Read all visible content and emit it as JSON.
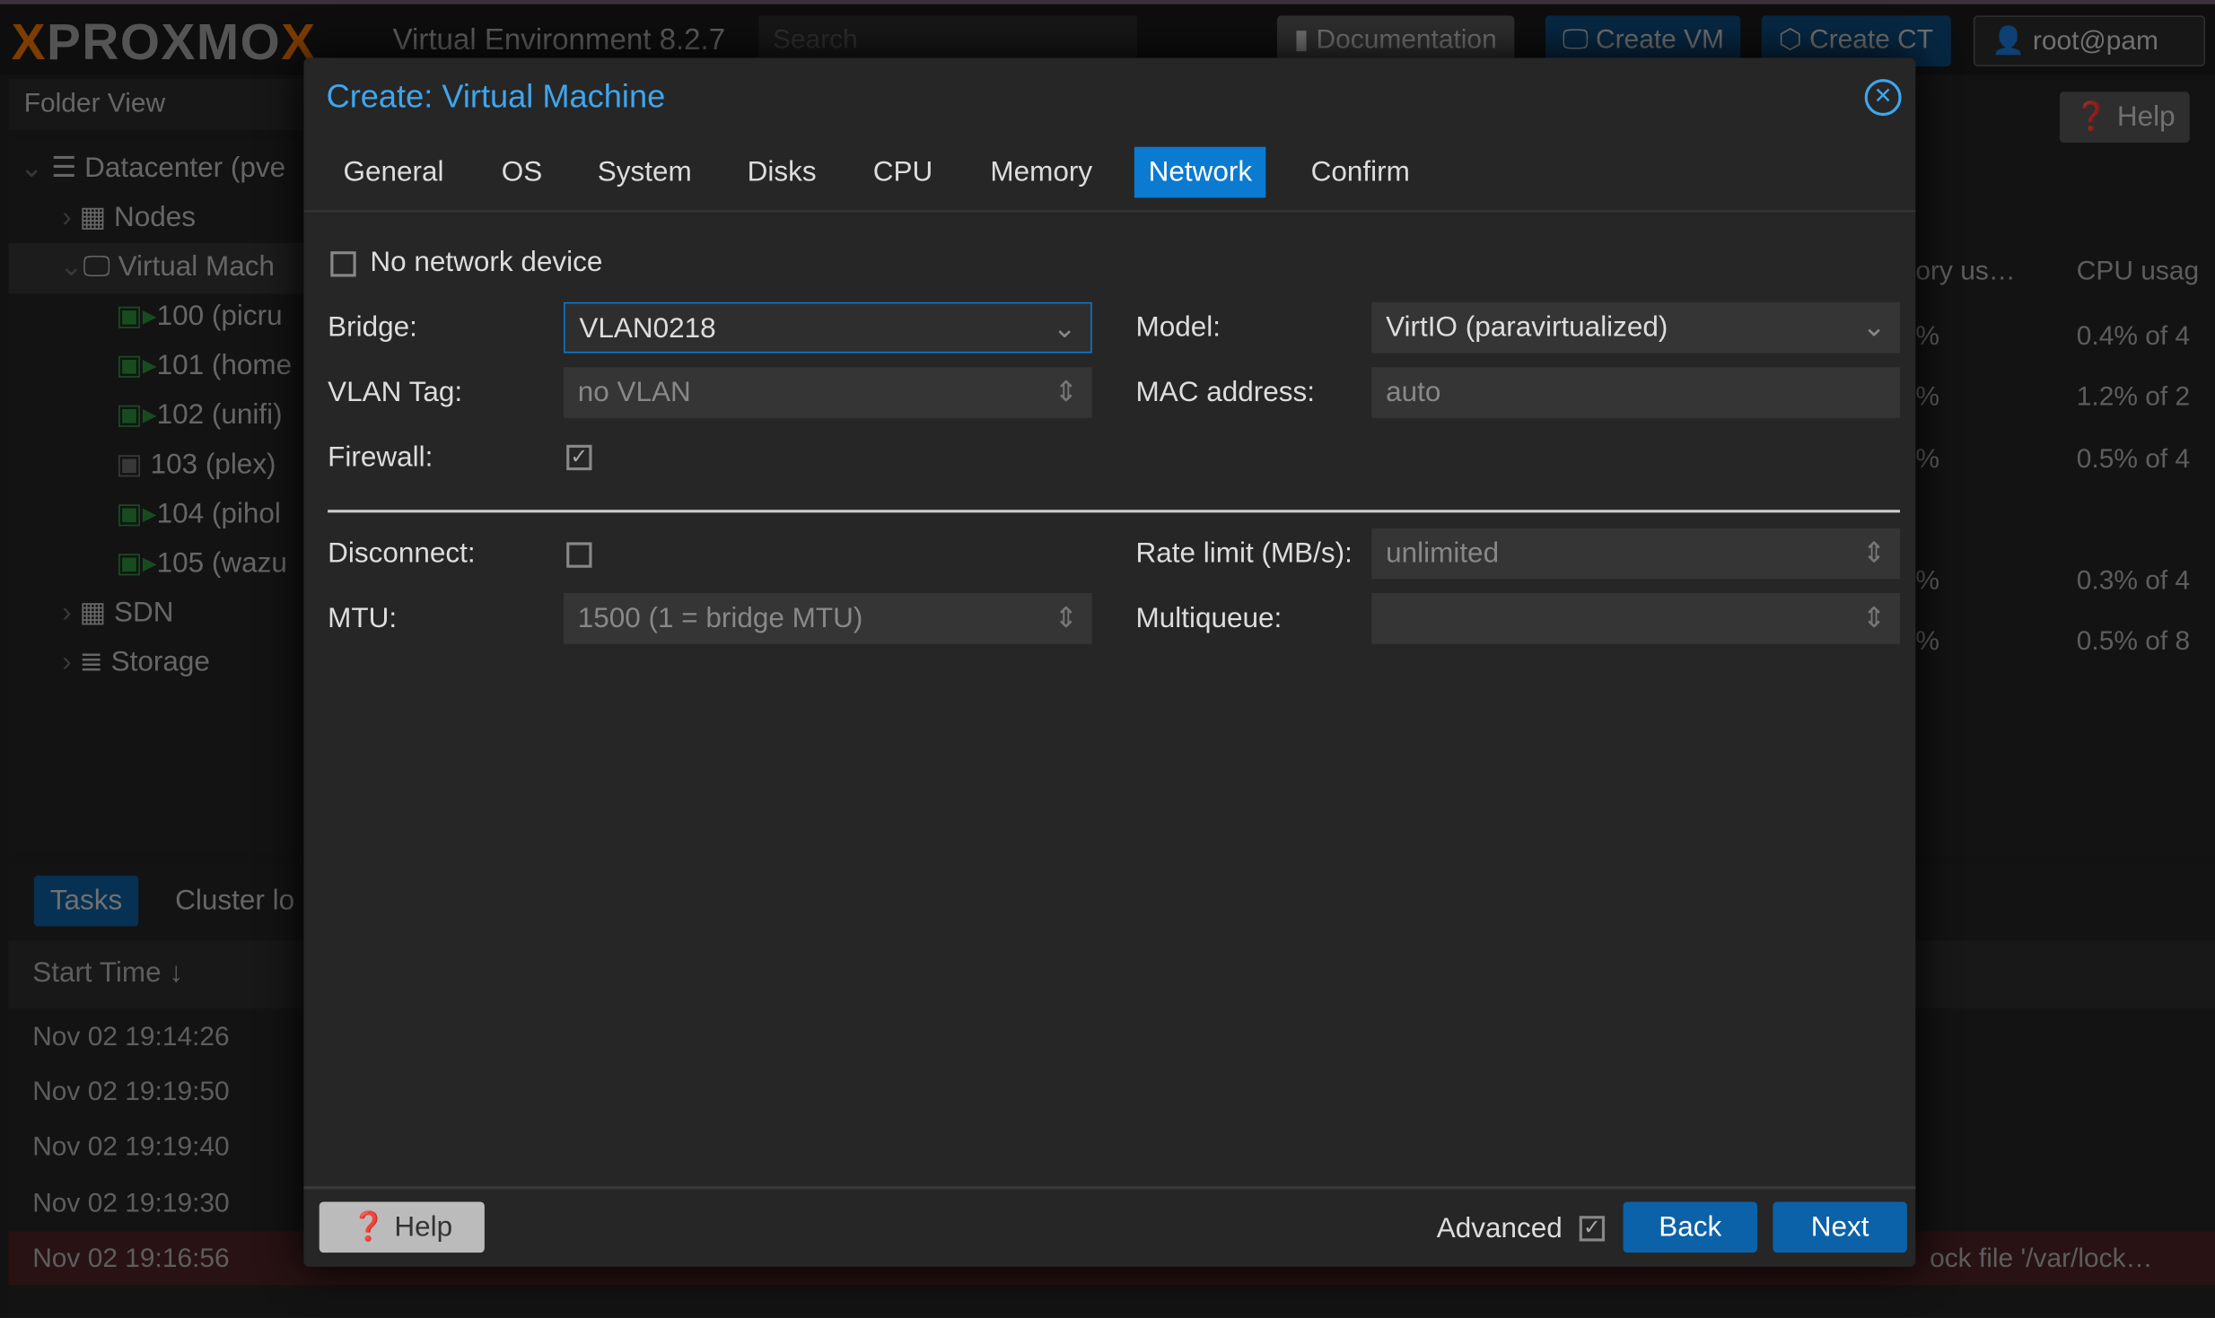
{
  "topbar": {
    "logo": "PROXMOX",
    "version": "Virtual Environment 8.2.7",
    "search_placeholder": "Search",
    "documentation": "Documentation",
    "create_vm": "Create VM",
    "create_ct": "Create CT",
    "user": "root@pam",
    "help": "Help"
  },
  "sidebar": {
    "view": "Folder View",
    "tree": [
      {
        "label": "Datacenter (pve",
        "icon": "server-rack-icon"
      },
      {
        "label": "Nodes",
        "icon": "building-icon"
      },
      {
        "label": "Virtual Mach",
        "icon": "monitor-icon"
      },
      {
        "label": "100 (picru",
        "icon": "vm-running-icon"
      },
      {
        "label": "101 (home",
        "icon": "vm-running-icon"
      },
      {
        "label": "102 (unifi)",
        "icon": "vm-running-icon"
      },
      {
        "label": "103 (plex)",
        "icon": "vm-stopped-icon"
      },
      {
        "label": "104 (pihol",
        "icon": "vm-running-icon"
      },
      {
        "label": "105 (wazu",
        "icon": "vm-running-icon"
      },
      {
        "label": "SDN",
        "icon": "grid-icon"
      },
      {
        "label": "Storage",
        "icon": "database-icon"
      }
    ]
  },
  "grid": {
    "headers": [
      "ory us…",
      "CPU usag"
    ],
    "rows": [
      [
        "%",
        "0.4% of 4"
      ],
      [
        "%",
        "1.2% of 2"
      ],
      [
        "%",
        "0.5% of 4"
      ],
      [
        "",
        ""
      ],
      [
        "%",
        "0.3% of 4"
      ],
      [
        "%",
        "0.5% of 8"
      ]
    ]
  },
  "tasks": {
    "tabs": [
      "Tasks",
      "Cluster lo"
    ],
    "column": "Start Time",
    "rows": [
      "Nov 02 19:14:26",
      "Nov 02 19:19:50",
      "Nov 02 19:19:40",
      "Nov 02 19:19:30",
      "Nov 02 19:16:56"
    ],
    "error_text": "ock file '/var/lock…"
  },
  "dialog": {
    "title": "Create: Virtual Machine",
    "tabs": [
      "General",
      "OS",
      "System",
      "Disks",
      "CPU",
      "Memory",
      "Network",
      "Confirm"
    ],
    "active_tab": "Network",
    "no_network": "No network device",
    "bridge_label": "Bridge:",
    "bridge": "VLAN0218",
    "vlan_label": "VLAN Tag:",
    "vlan_placeholder": "no VLAN",
    "firewall_label": "Firewall:",
    "firewall": true,
    "model_label": "Model:",
    "model": "VirtIO (paravirtualized)",
    "mac_label": "MAC address:",
    "mac_placeholder": "auto",
    "disconnect_label": "Disconnect:",
    "disconnect": false,
    "mtu_label": "MTU:",
    "mtu_placeholder": "1500 (1 = bridge MTU)",
    "rate_label": "Rate limit (MB/s):",
    "rate_placeholder": "unlimited",
    "multiqueue_label": "Multiqueue:",
    "help": "Help",
    "advanced": "Advanced",
    "advanced_checked": true,
    "back": "Back",
    "next": "Next"
  },
  "colors": {
    "accent": "#0b7ad1",
    "title": "#3ea6ef",
    "logo_orange": "#e57000",
    "error_row": "#4a2224"
  }
}
